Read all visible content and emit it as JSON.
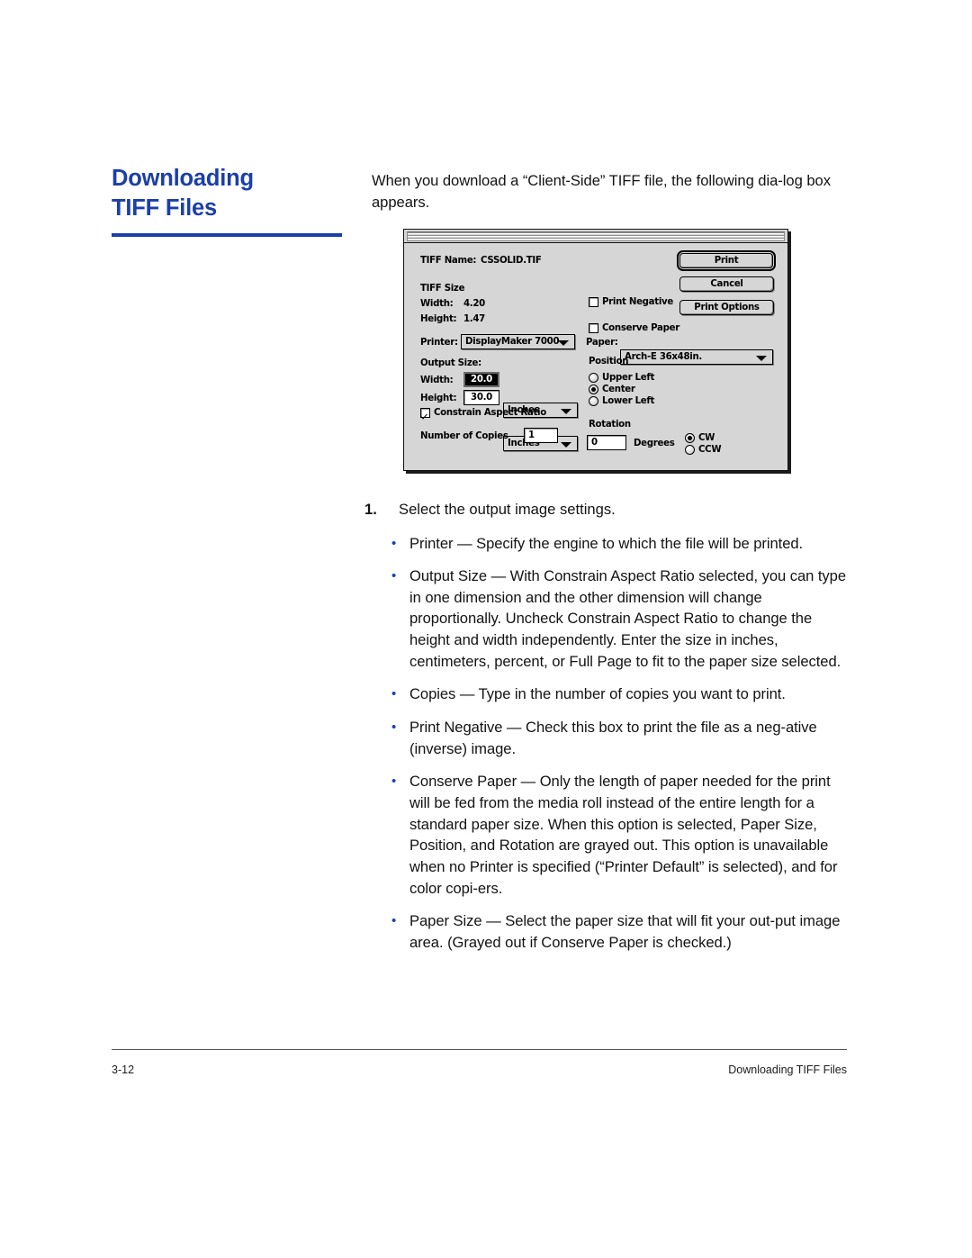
{
  "heading": {
    "line1": "Downloading",
    "line2": "TIFF Files"
  },
  "intro": {
    "paragraph": "When you download a “Client-Side” TIFF file, the following dia-log box appears."
  },
  "dialog": {
    "tiff_name_label": "TIFF Name:",
    "tiff_name_value": "CSSOLID.TIF",
    "tiff_size_label": "TIFF Size",
    "tiff_width_label": "Width:",
    "tiff_width_value": "4.20",
    "tiff_height_label": "Height:",
    "tiff_height_value": "1.47",
    "print_negative_label": "Print Negative",
    "print_negative_checked": false,
    "conserve_paper_label": "Conserve Paper",
    "conserve_paper_checked": false,
    "print_button": "Print",
    "cancel_button": "Cancel",
    "print_options_button": "Print Options",
    "printer_label": "Printer:",
    "printer_value": "DisplayMaker 7000",
    "paper_label": "Paper:",
    "paper_value": "Arch-E 36x48in.",
    "output_size_label": "Output Size:",
    "output_width_label": "Width:",
    "output_width_value": "20.0",
    "output_width_unit": "Inches",
    "output_height_label": "Height:",
    "output_height_value": "30.0",
    "output_height_unit": "Inches",
    "constrain_label": "Constrain Aspect Ratio",
    "constrain_checked": true,
    "copies_label": "Number of Copies",
    "copies_value": "1",
    "position_label": "Position",
    "position_options": [
      "Upper Left",
      "Center",
      "Lower Left"
    ],
    "position_selected": "Center",
    "rotation_label": "Rotation",
    "rotation_value": "0",
    "degrees_label": "Degrees",
    "rotation_direction_options": [
      "CW",
      "CCW"
    ],
    "rotation_direction_selected": "CW"
  },
  "steps": [
    {
      "number": "1.",
      "text": "Select the output image settings."
    }
  ],
  "bullets": [
    {
      "dot": "•",
      "text": "Printer — Specify the engine to which the file will be printed."
    },
    {
      "dot": "•",
      "text": "Output Size — With Constrain Aspect Ratio selected, you can type in one dimension and the other dimension will change proportionally. Uncheck Constrain Aspect Ratio to change the height and width independently. Enter the size in inches, centimeters, percent, or Full Page to fit to the paper size selected."
    },
    {
      "dot": "•",
      "text": "Copies — Type in the number of copies you want to print."
    },
    {
      "dot": "•",
      "text": "Print Negative — Check this box to print the file as a neg-ative (inverse) image."
    },
    {
      "dot": "•",
      "text": "Conserve Paper — Only the length of paper needed for the print will be fed from the media roll instead of the entire length for a standard paper size. When this option is selected, Paper Size, Position, and Rotation are grayed out. This option is unavailable when no Printer is specified (“Printer Default” is selected), and for color copi-ers."
    },
    {
      "dot": "•",
      "text": "Paper Size — Select the paper size that will fit your out-put image area. (Grayed out if Conserve Paper is checked.)"
    }
  ],
  "footer": {
    "page_number": "3-12",
    "section_title": "Downloading TIFF Files"
  },
  "colors": {
    "accent_blue": "#1b3fa8",
    "dialog_gray": "#d6d6d6",
    "body_text": "#131313"
  }
}
